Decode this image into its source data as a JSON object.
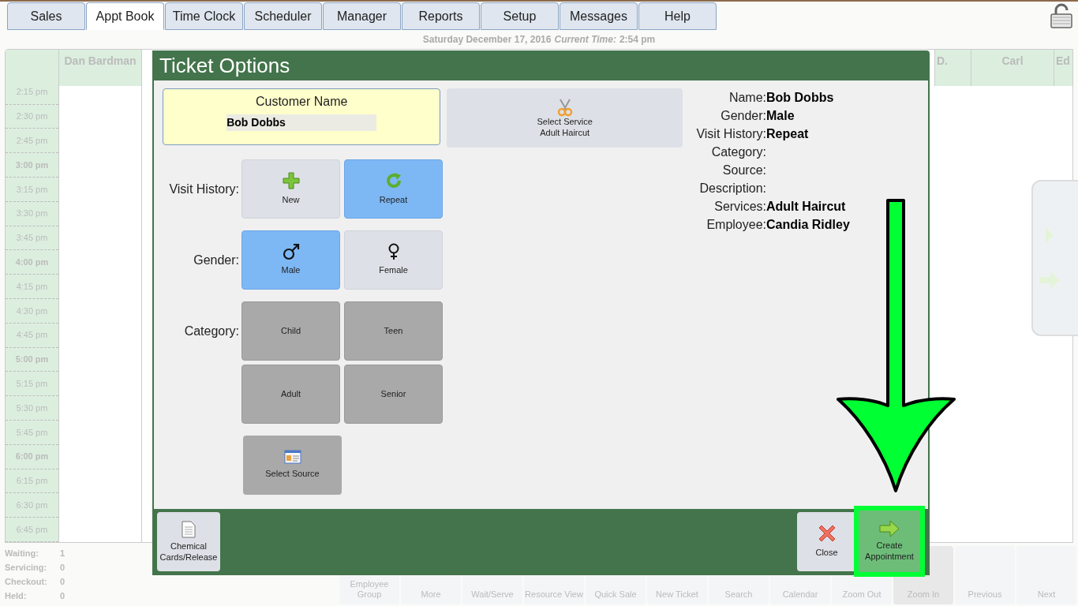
{
  "nav_tabs": [
    {
      "label": "Sales",
      "selected": false
    },
    {
      "label": "Appt Book",
      "selected": true
    },
    {
      "label": "Time Clock",
      "selected": false
    },
    {
      "label": "Scheduler",
      "selected": false
    },
    {
      "label": "Manager",
      "selected": false
    },
    {
      "label": "Reports",
      "selected": false
    },
    {
      "label": "Setup",
      "selected": false
    },
    {
      "label": "Messages",
      "selected": false
    },
    {
      "label": "Help",
      "selected": false
    }
  ],
  "date_line": {
    "date": "Saturday December 17, 2016",
    "current_time_label": "Current Time:",
    "current_time": "2:54 pm"
  },
  "calendar": {
    "columns_left": [
      "Dan Bardman"
    ],
    "columns_right": [
      "D.",
      "Carl",
      "Ed"
    ],
    "times": [
      {
        "label": "2:15 pm",
        "hour": false
      },
      {
        "label": "2:30 pm",
        "hour": false
      },
      {
        "label": "2:45 pm",
        "hour": false
      },
      {
        "label": "3:00 pm",
        "hour": true
      },
      {
        "label": "3:15 pm",
        "hour": false
      },
      {
        "label": "3:30 pm",
        "hour": false
      },
      {
        "label": "3:45 pm",
        "hour": false
      },
      {
        "label": "4:00 pm",
        "hour": true
      },
      {
        "label": "4:15 pm",
        "hour": false
      },
      {
        "label": "4:30 pm",
        "hour": false
      },
      {
        "label": "4:45 pm",
        "hour": false
      },
      {
        "label": "5:00 pm",
        "hour": true
      },
      {
        "label": "5:15 pm",
        "hour": false
      },
      {
        "label": "5:30 pm",
        "hour": false
      },
      {
        "label": "5:45 pm",
        "hour": false
      },
      {
        "label": "6:00 pm",
        "hour": true
      },
      {
        "label": "6:15 pm",
        "hour": false
      },
      {
        "label": "6:30 pm",
        "hour": false
      },
      {
        "label": "6:45 pm",
        "hour": false
      }
    ]
  },
  "status_counts": [
    {
      "label": "Waiting:",
      "value": "1"
    },
    {
      "label": "Servicing:",
      "value": "0"
    },
    {
      "label": "Checkout:",
      "value": "0"
    },
    {
      "label": "Held:",
      "value": "0"
    }
  ],
  "toolbar": [
    {
      "label": "Employee Group",
      "selected": false
    },
    {
      "label": "More",
      "selected": false
    },
    {
      "label": "Wait/Serve",
      "selected": false
    },
    {
      "label": "Resource View",
      "selected": false
    },
    {
      "label": "Quick Sale",
      "selected": false
    },
    {
      "label": "New Ticket",
      "selected": false
    },
    {
      "label": "Search",
      "selected": false
    },
    {
      "label": "Calendar",
      "selected": false
    },
    {
      "label": "Zoom Out",
      "selected": false
    },
    {
      "label": "Zoom In",
      "selected": true
    },
    {
      "label": "Previous",
      "selected": false
    },
    {
      "label": "Next",
      "selected": false
    }
  ],
  "dialog": {
    "title": "Ticket Options",
    "customer": {
      "label": "Customer Name",
      "value": "Bob Dobbs"
    },
    "service": {
      "label": "Select Service",
      "value": "Adult Haircut"
    },
    "groups": [
      {
        "label": "Visit History:",
        "options": [
          {
            "label": "New",
            "kind": "new",
            "selected": false
          },
          {
            "label": "Repeat",
            "kind": "repeat",
            "selected": true
          }
        ]
      },
      {
        "label": "Gender:",
        "options": [
          {
            "label": "Male",
            "kind": "male",
            "selected": true
          },
          {
            "label": "Female",
            "kind": "female",
            "selected": false
          }
        ]
      },
      {
        "label": "Category:",
        "options": [
          {
            "label": "Child",
            "kind": "plain",
            "selected": false
          },
          {
            "label": "Teen",
            "kind": "plain",
            "selected": false
          },
          {
            "label": "Adult",
            "kind": "plain",
            "selected": false
          },
          {
            "label": "Senior",
            "kind": "plain",
            "selected": false
          }
        ]
      }
    ],
    "source_button": "Select Source",
    "summary": [
      {
        "label": "Name:",
        "value": "Bob Dobbs"
      },
      {
        "label": "Gender:",
        "value": "Male"
      },
      {
        "label": "Visit History:",
        "value": "Repeat"
      },
      {
        "label": "Category:"
      },
      {
        "label": "Source:"
      },
      {
        "label": "Description:"
      },
      {
        "label": "Services:",
        "value": "Adult Haircut"
      },
      {
        "label": "Employee:",
        "value": "Candia Ridley"
      }
    ],
    "footer": {
      "chemical": "Chemical Cards/Release",
      "close": "Close",
      "create": "Create Appointment"
    }
  }
}
